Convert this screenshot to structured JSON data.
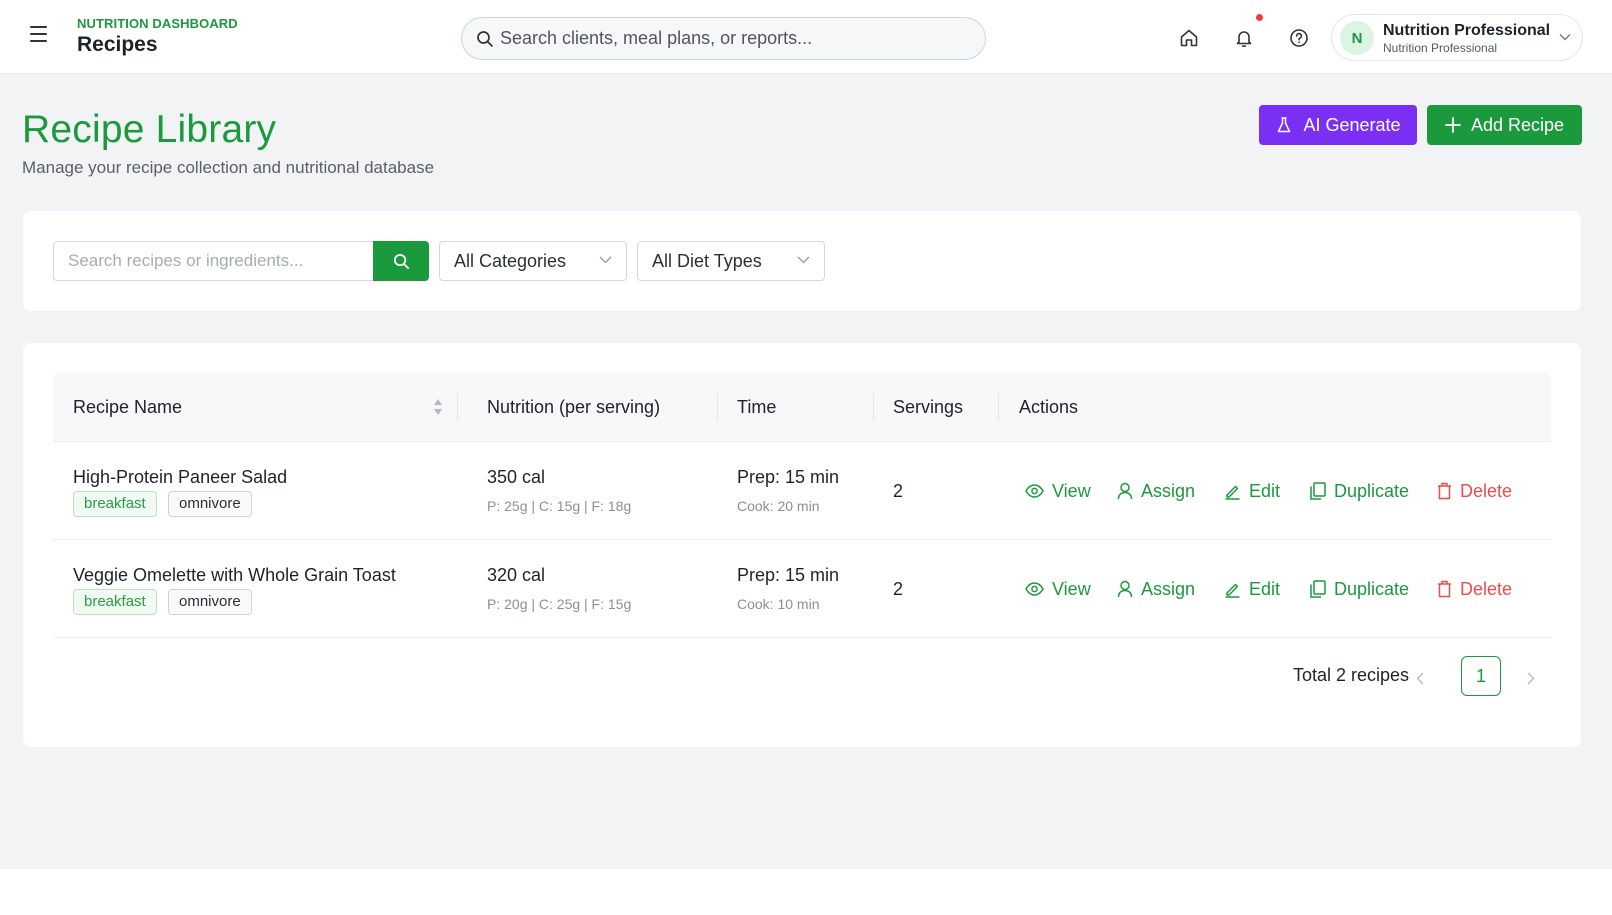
{
  "header": {
    "kicker": "NUTRITION DASHBOARD",
    "title": "Recipes",
    "search_placeholder": "Search clients, meal plans, or reports...",
    "user": {
      "initial": "N",
      "name": "Nutrition Professional",
      "role": "Nutrition Professional"
    },
    "icons": [
      "menu-icon",
      "home-icon",
      "bell-icon",
      "help-icon",
      "chevron-down-icon"
    ]
  },
  "page": {
    "title": "Recipe Library",
    "subtitle": "Manage your recipe collection and nutritional database",
    "ai_button": "AI Generate",
    "add_button": "Add Recipe"
  },
  "filters": {
    "search_placeholder": "Search recipes or ingredients...",
    "category": "All Categories",
    "diet": "All Diet Types"
  },
  "table": {
    "columns": [
      "Recipe Name",
      "Nutrition (per serving)",
      "Time",
      "Servings",
      "Actions"
    ],
    "rows": [
      {
        "name": "High-Protein Paneer Salad",
        "tags": [
          "breakfast",
          "omnivore"
        ],
        "calories": "350 cal",
        "macros": "P: 25g | C: 15g | F: 18g",
        "prep": "Prep: 15 min",
        "cook": "Cook: 20 min",
        "servings": "2"
      },
      {
        "name": "Veggie Omelette with Whole Grain Toast",
        "tags": [
          "breakfast",
          "omnivore"
        ],
        "calories": "320 cal",
        "macros": "P: 20g | C: 25g | F: 15g",
        "prep": "Prep: 15 min",
        "cook": "Cook: 10 min",
        "servings": "2"
      }
    ],
    "actions": {
      "view": "View",
      "assign": "Assign",
      "edit": "Edit",
      "duplicate": "Duplicate",
      "delete": "Delete"
    }
  },
  "pagination": {
    "total": "Total 2 recipes",
    "current": "1"
  },
  "colors": {
    "green": "#1a9a3c",
    "purple": "#7b2ff2",
    "red": "#ef4b4b",
    "background": "#f2f3f5"
  }
}
